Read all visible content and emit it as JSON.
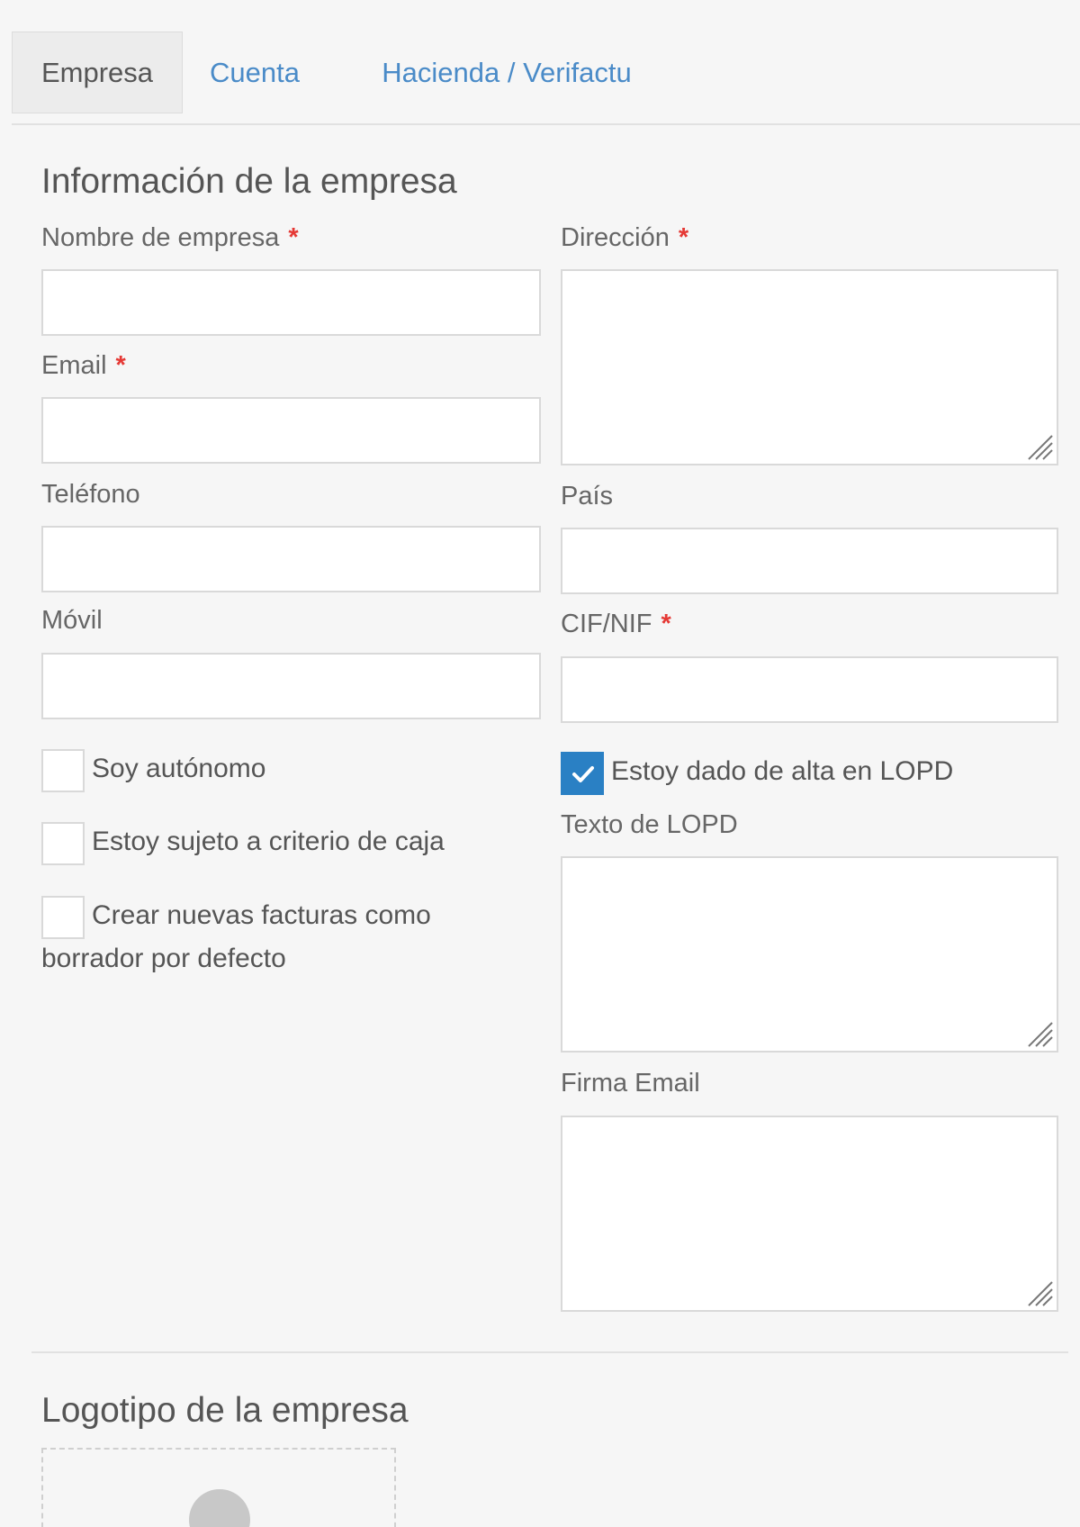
{
  "tabs": [
    {
      "label": "Empresa",
      "active": true
    },
    {
      "label": "Cuenta",
      "active": false
    },
    {
      "label": "Hacienda / Verifactu",
      "active": false
    }
  ],
  "company_info": {
    "title": "Información de la empresa",
    "required_mark": "*",
    "fields": {
      "company_name": {
        "label": "Nombre de empresa",
        "value": "",
        "required": true
      },
      "address": {
        "label": "Dirección",
        "value": "",
        "required": true
      },
      "email": {
        "label": "Email",
        "value": "",
        "required": true
      },
      "phone": {
        "label": "Teléfono",
        "value": "",
        "required": false
      },
      "country": {
        "label": "País",
        "value": "",
        "required": false
      },
      "mobile": {
        "label": "Móvil",
        "value": "",
        "required": false
      },
      "tax_id": {
        "label": "CIF/NIF",
        "value": "",
        "required": true
      },
      "lopd_text": {
        "label": "Texto de LOPD",
        "value": ""
      },
      "email_signature": {
        "label": "Firma Email",
        "value": ""
      }
    },
    "checkboxes": {
      "self_employed": {
        "label": "Soy autónomo",
        "checked": false
      },
      "cash_criterion": {
        "label": "Estoy sujeto a criterio de caja",
        "checked": false
      },
      "draft_default": {
        "label": "Crear nuevas facturas como borrador por defecto",
        "label_line1": "Crear nuevas facturas como",
        "label_line2": "borrador por defecto",
        "checked": false
      },
      "lopd_registered": {
        "label": "Estoy dado de alta en LOPD",
        "checked": true
      }
    }
  },
  "logo_section": {
    "title": "Logotipo de la empresa"
  },
  "colors": {
    "accent": "#2a80c4",
    "link": "#4a8bc8",
    "required": "#e53935",
    "background": "#f6f6f6"
  }
}
